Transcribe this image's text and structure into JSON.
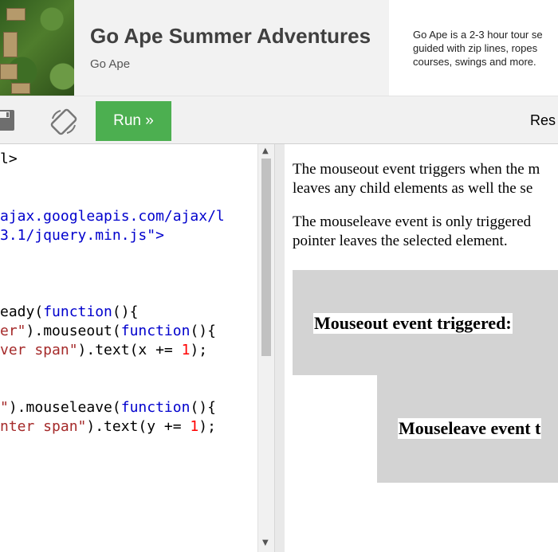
{
  "ad": {
    "title": "Go Ape Summer Adventures",
    "advertiser": "Go Ape",
    "description_lines": [
      "Go Ape is a 2-3 hour tour se",
      "guided with zip lines, ropes",
      "courses, swings and more."
    ]
  },
  "toolbar": {
    "save_icon": "save-icon",
    "rotate_icon": "rotate-icon",
    "run_label": "Run »",
    "result_label": "Res"
  },
  "editor": {
    "lines": [
      [
        {
          "t": "l>",
          "c": "plain"
        }
      ],
      [],
      [],
      [
        {
          "t": "ajax.googleapis.com/ajax/l",
          "c": "tag"
        }
      ],
      [
        {
          "t": "3.1/jquery.min.js\">",
          "c": "tag"
        }
      ],
      [],
      [],
      [],
      [
        {
          "t": "eady(",
          "c": "plain"
        },
        {
          "t": "function",
          "c": "kw"
        },
        {
          "t": "(){",
          "c": "plain"
        }
      ],
      [
        {
          "t": "er\"",
          "c": "str"
        },
        {
          "t": ").mouseout(",
          "c": "plain"
        },
        {
          "t": "function",
          "c": "kw"
        },
        {
          "t": "(){",
          "c": "plain"
        }
      ],
      [
        {
          "t": "ver span\"",
          "c": "str"
        },
        {
          "t": ").text(x += ",
          "c": "plain"
        },
        {
          "t": "1",
          "c": "num"
        },
        {
          "t": ");",
          "c": "plain"
        }
      ],
      [],
      [],
      [
        {
          "t": "\"",
          "c": "str"
        },
        {
          "t": ").mouseleave(",
          "c": "plain"
        },
        {
          "t": "function",
          "c": "kw"
        },
        {
          "t": "(){",
          "c": "plain"
        }
      ],
      [
        {
          "t": "nter span\"",
          "c": "str"
        },
        {
          "t": ").text(y += ",
          "c": "plain"
        },
        {
          "t": "1",
          "c": "num"
        },
        {
          "t": ");",
          "c": "plain"
        }
      ]
    ]
  },
  "result": {
    "para1_line1": "The mouseout event triggers when the m",
    "para1_line2": "leaves any child elements as well the se",
    "para2_line1": "The mouseleave event is only triggered",
    "para2_line2": "pointer leaves the selected element.",
    "box1_label": "Mouseout event triggered:",
    "box2_label": "Mouseleave event t",
    "box_color": "#d3d3d3"
  },
  "colors": {
    "run_button": "#4caf50",
    "keyword": "#0000cd",
    "string": "#a52a2a",
    "number": "#ff0000"
  }
}
